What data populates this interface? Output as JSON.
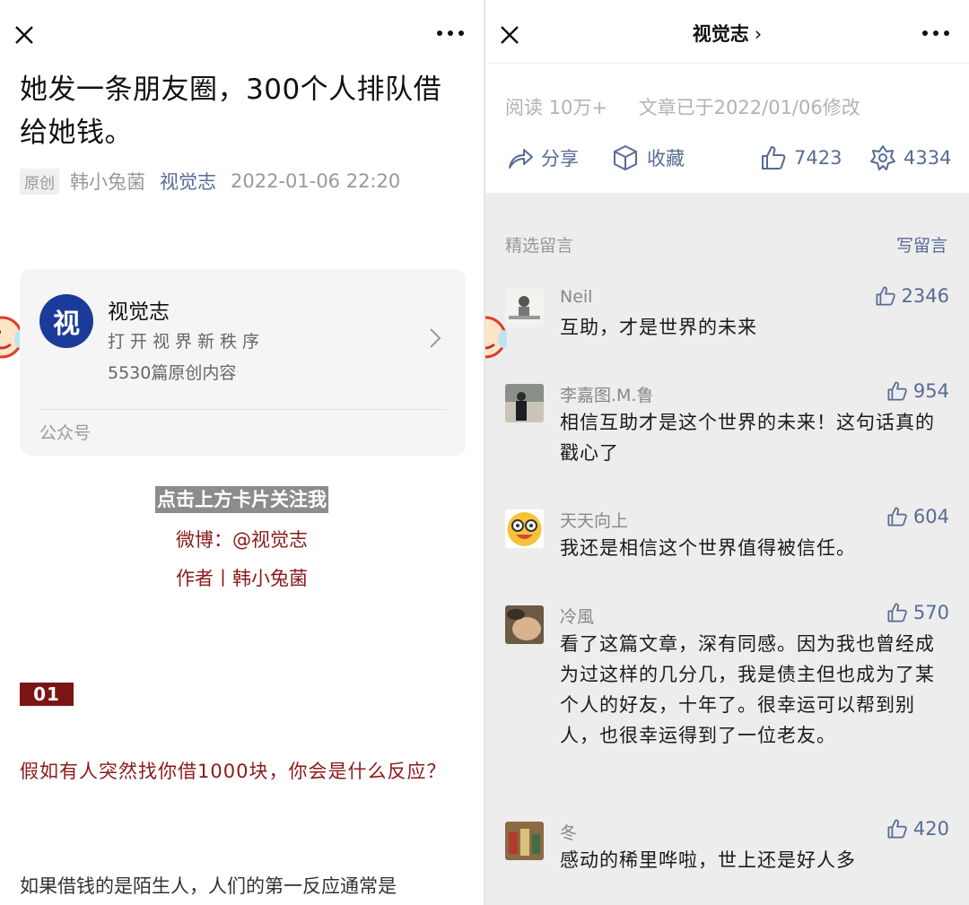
{
  "left": {
    "title": "她发一条朋友圈，300个人排队借给她钱。",
    "meta": {
      "tag": "原创",
      "author": "韩小兔菌",
      "account": "视觉志",
      "datetime": "2022-01-06 22:20"
    },
    "card": {
      "avatar_char": "视",
      "name": "视觉志",
      "slogan": "打开视界新秩序",
      "count": "5530篇原创内容",
      "type": "公众号"
    },
    "follow": "点击上方卡片关注我",
    "weibo": "微博：@视觉志",
    "author_line": "作者丨韩小兔菌",
    "section": "01",
    "question": "假如有人突然找你借1000块，你会是什么反应？",
    "paragraph": "如果借钱的是陌生人，人们的第一反应通常是"
  },
  "right": {
    "title": "视觉志",
    "read": "阅读 10万+",
    "modified": "文章已于2022/01/06修改",
    "share": "分享",
    "favorite": "收藏",
    "likes": "7423",
    "wow": "4334",
    "selected": "精选留言",
    "write": "写留言",
    "comments": [
      {
        "name": "Neil",
        "likes": "2346",
        "text": "互助，才是世界的未来"
      },
      {
        "name": "李嘉图.M.鲁",
        "likes": "954",
        "text": "相信互助才是这个世界的未来！这句话真的戳心了"
      },
      {
        "name": "天天向上",
        "likes": "604",
        "text": "我还是相信这个世界值得被信任。"
      },
      {
        "name": "冷風",
        "likes": "570",
        "text": "看了这篇文章，深有同感。因为我也曾经成为过这样的几分几，我是债主但也成为了某个人的好友，十年了。很幸运可以帮到别人，也很幸运得到了一位老友。"
      },
      {
        "name": "冬",
        "likes": "420",
        "text": "感动的稀里哗啦，世上还是好人多"
      }
    ]
  },
  "colors": {
    "link": "#576b95",
    "accent_red": "#8b1a1a",
    "section_bg": "#7b1515",
    "brand_blue": "#1a3b9a"
  },
  "icons": [
    "close-icon",
    "more-icon",
    "chevron-right-icon",
    "share-icon",
    "favorite-icon",
    "thumb-up-icon",
    "wow-icon"
  ]
}
